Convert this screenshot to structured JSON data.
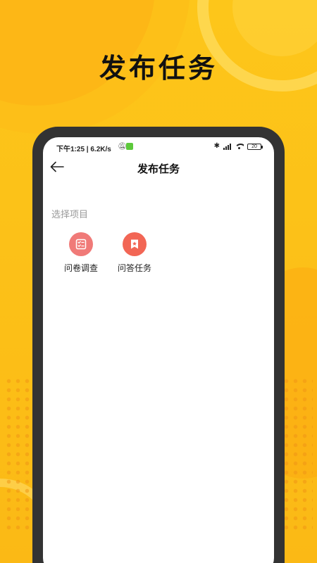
{
  "headline": "发布任务",
  "status_bar": {
    "time_speed": "下午1:25 | 6.2K/s",
    "battery": "20"
  },
  "nav": {
    "title": "发布任务"
  },
  "section": {
    "label": "选择项目"
  },
  "items": [
    {
      "label": "问卷调查",
      "icon": "survey-clipboard-icon",
      "color": "#f07a78"
    },
    {
      "label": "问答任务",
      "icon": "star-bookmark-icon",
      "color": "#f26655"
    }
  ],
  "colors": {
    "background": "#fcc31a",
    "phone_frame": "#333333"
  }
}
